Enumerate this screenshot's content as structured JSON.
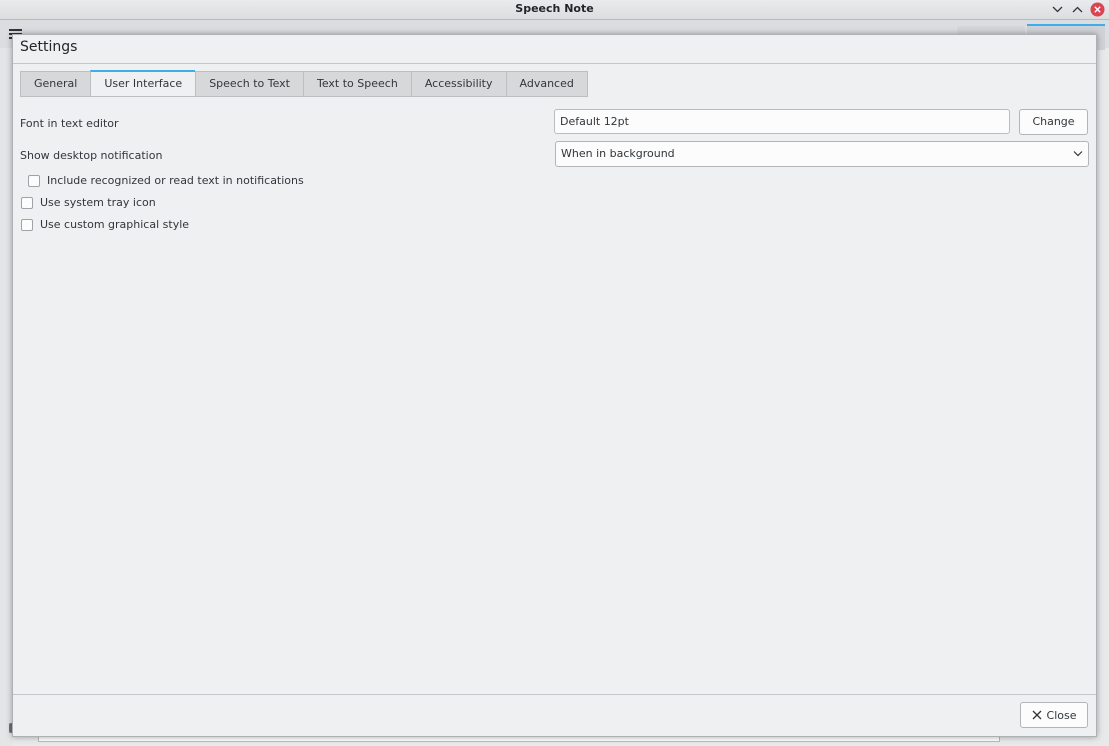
{
  "window": {
    "title": "Speech Note"
  },
  "dialog": {
    "title": "Settings",
    "tabs": [
      {
        "label": "General",
        "active": false
      },
      {
        "label": "User Interface",
        "active": true
      },
      {
        "label": "Speech to Text",
        "active": false
      },
      {
        "label": "Text to Speech",
        "active": false
      },
      {
        "label": "Accessibility",
        "active": false
      },
      {
        "label": "Advanced",
        "active": false
      }
    ],
    "font": {
      "label": "Font in text editor",
      "value": "Default 12pt",
      "change_label": "Change"
    },
    "notification": {
      "label": "Show desktop notification",
      "selected": "When in background"
    },
    "checkboxes": [
      {
        "label": "Include recognized or read text in notifications",
        "checked": false
      },
      {
        "label": "Use system tray icon",
        "checked": false
      },
      {
        "label": "Use custom graphical style",
        "checked": false
      }
    ],
    "close_label": "Close"
  },
  "colors": {
    "accent": "#3daee9",
    "close_icon": "#da4453"
  },
  "icons": {
    "minimize": "chevron-down-icon",
    "maximize": "chevron-up-icon",
    "window_close": "close-circle-icon",
    "select_arrow": "chevron-down-icon",
    "close_button": "close-icon"
  }
}
